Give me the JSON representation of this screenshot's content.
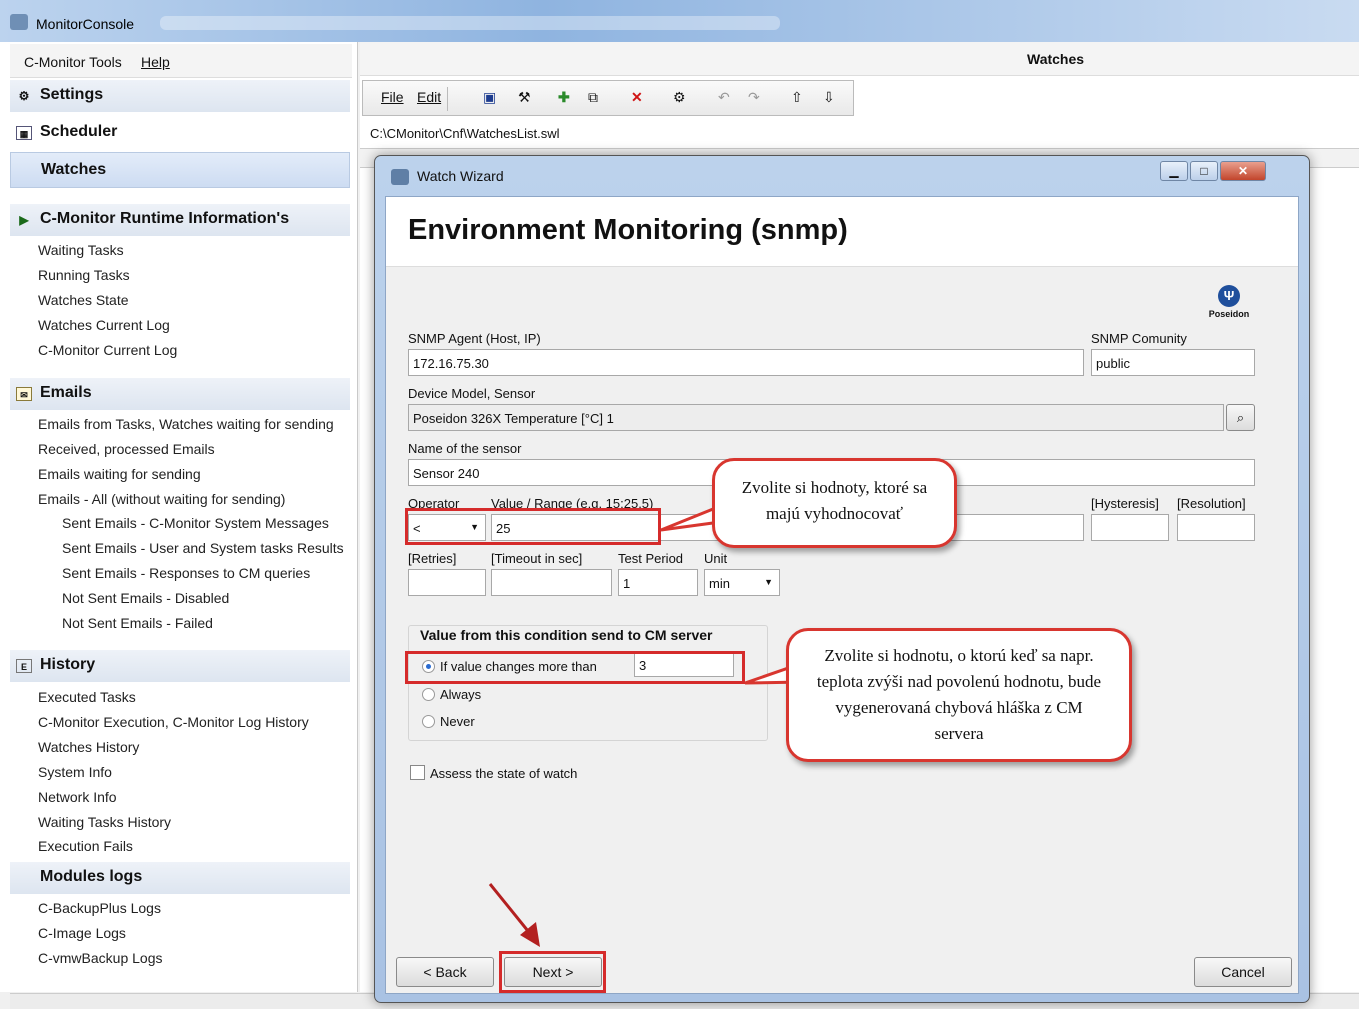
{
  "window": {
    "title": "MonitorConsole"
  },
  "menu": {
    "tools": "C-Monitor Tools",
    "help": "Help"
  },
  "sidebar": {
    "settings": "Settings",
    "scheduler": "Scheduler",
    "watches": "Watches",
    "runtime_header": "C-Monitor Runtime Information's",
    "runtime_items": [
      "Waiting Tasks",
      "Running Tasks",
      "Watches State",
      "Watches Current Log",
      "C-Monitor Current Log"
    ],
    "emails_header": "Emails",
    "email_items": [
      "Emails from Tasks, Watches waiting for sending",
      "Received, processed Emails",
      "Emails waiting for sending",
      "Emails - All (without waiting for sending)",
      "Sent Emails - C-Monitor System Messages",
      "Sent Emails - User and System tasks Results",
      "Sent Emails - Responses to CM queries",
      "Not Sent Emails - Disabled",
      "Not Sent Emails - Failed"
    ],
    "history_header": "History",
    "history_items": [
      "Executed Tasks",
      "C-Monitor Execution, C-Monitor Log History",
      "Watches History",
      "System Info",
      "Network Info",
      "Waiting Tasks History",
      "Execution Fails"
    ],
    "modules_header": "Modules logs",
    "module_items": [
      "C-BackupPlus Logs",
      "C-Image Logs",
      "C-vmwBackup Logs"
    ]
  },
  "main": {
    "title": "Watches",
    "menu_file": "File",
    "menu_edit": "Edit",
    "path": "C:\\CMonitor\\Cnf\\WatchesList.swl"
  },
  "dialog": {
    "title": "Watch Wizard",
    "heading": "Environment Monitoring (snmp)",
    "logo_text": "Poseidon",
    "agent_label": "SNMP Agent (Host, IP)",
    "agent_value": "172.16.75.30",
    "community_label": "SNMP Comunity",
    "community_value": "public",
    "device_label": "Device Model, Sensor",
    "device_value": "Poseidon 326X Temperature [°C] 1",
    "sensor_label": "Name of the sensor",
    "sensor_value": "Sensor 240",
    "operator_label": "Operator",
    "operator_value": "<",
    "value_label": "Value / Range (e.g. 15;25.5)",
    "value_value": "25",
    "hysteresis_label": "[Hysteresis]",
    "resolution_label": "[Resolution]",
    "retries_label": "[Retries]",
    "timeout_label": "[Timeout in sec]",
    "period_label": "Test Period",
    "period_value": "1",
    "unit_label": "Unit",
    "unit_value": "min",
    "send_group_label": "Value from this condition send to CM server",
    "radio_changes": "If value changes more than",
    "radio_changes_value": "3",
    "radio_always": "Always",
    "radio_never": "Never",
    "assess_label": "Assess the state of watch",
    "back_button": "< Back",
    "next_button": "Next >",
    "cancel_button": "Cancel"
  },
  "annotations": {
    "callout_1": "Zvolite si hodnoty, ktoré sa majú vyhodnocovať",
    "callout_2": "Zvolite si hodnotu, o ktorú keď sa napr. teplota zvýši nad povolenú hodnotu, bude vygenerovaná chybová hláška z CM servera"
  },
  "colors": {
    "annotation_red": "#d52b2b",
    "selected_nav": "#cddcf2"
  },
  "icons": [
    "app-icon",
    "settings-icon",
    "scheduler-icon",
    "play-icon",
    "email-icon",
    "history-icon",
    "save-icon",
    "add-icon",
    "delete-icon",
    "undo-icon",
    "redo-icon",
    "up-arrow-icon",
    "down-arrow-icon",
    "binoculars-icon",
    "poseidon-logo-icon"
  ]
}
